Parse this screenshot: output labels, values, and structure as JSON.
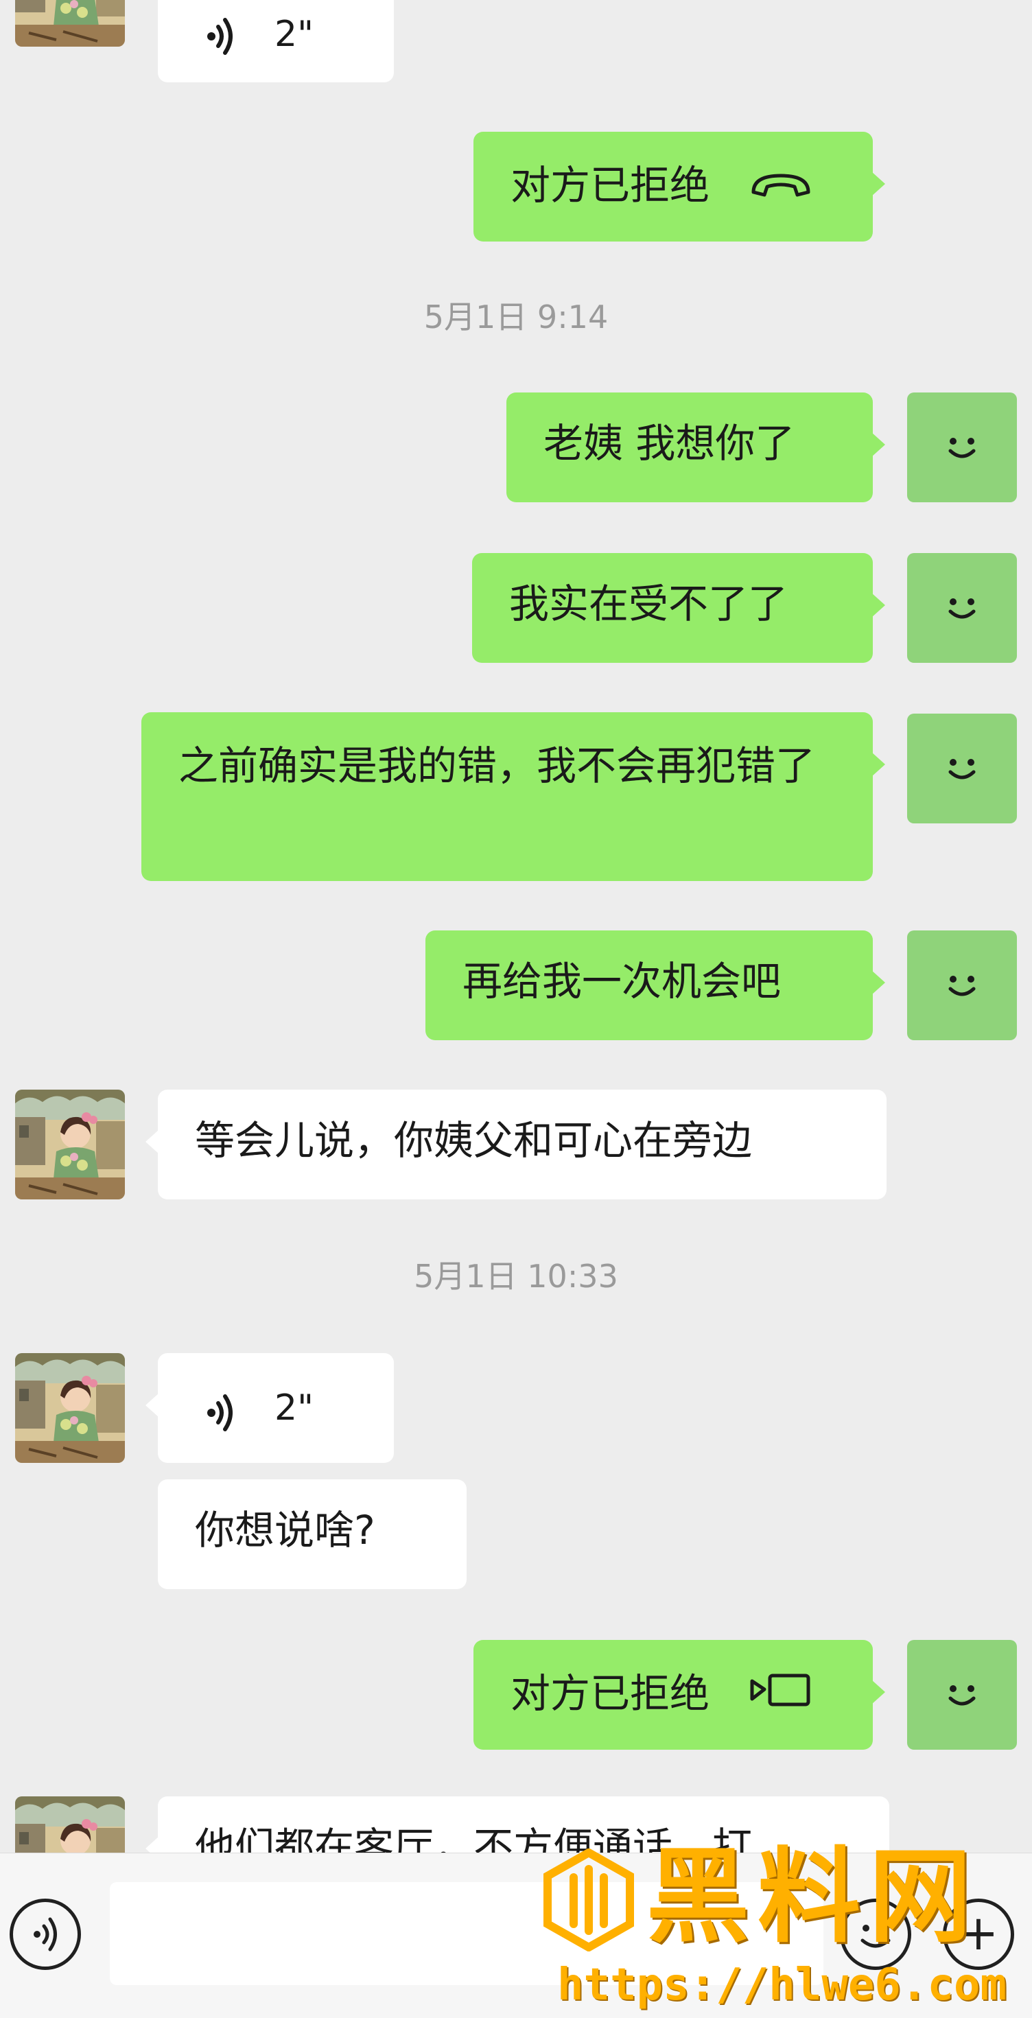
{
  "messages": {
    "m0_voice_duration": "2\"",
    "m1_call_text": "对方已拒绝",
    "m2_timestamp": "5月1日 9:14",
    "m3_text": "老姨 我想你了",
    "m4_text": "我实在受不了了",
    "m5_text": "之前确实是我的错，我不会再犯错了",
    "m6_text": "再给我一次机会吧",
    "m7_text": "等会儿说，你姨父和可心在旁边",
    "m8_timestamp": "5月1日 10:33",
    "m9_voice_duration": "2\"",
    "m10_text": "你想说啥?",
    "m11_call_text": "对方已拒绝",
    "m12_text": "他们都在客厅，不方便通话，打"
  },
  "icons": {
    "audio_call": "phone-hangup-icon",
    "video_call": "video-call-icon",
    "voice_wave": "voice-wave-icon",
    "my_avatar": "smiley-face-icon",
    "contact_avatar": "cartoon-girl-avatar",
    "voice_mode": "voice-mode-icon",
    "emoji": "emoji-icon",
    "more": "plus-icon"
  },
  "watermark": {
    "title": "黑料网",
    "url": "https://hlwe6.com"
  },
  "colors": {
    "background": "#ededed",
    "green_bubble": "#95ec69",
    "white_bubble": "#ffffff",
    "my_avatar": "#8fd37a",
    "timestamp": "#9a9a9a",
    "watermark": "#ffb000"
  }
}
